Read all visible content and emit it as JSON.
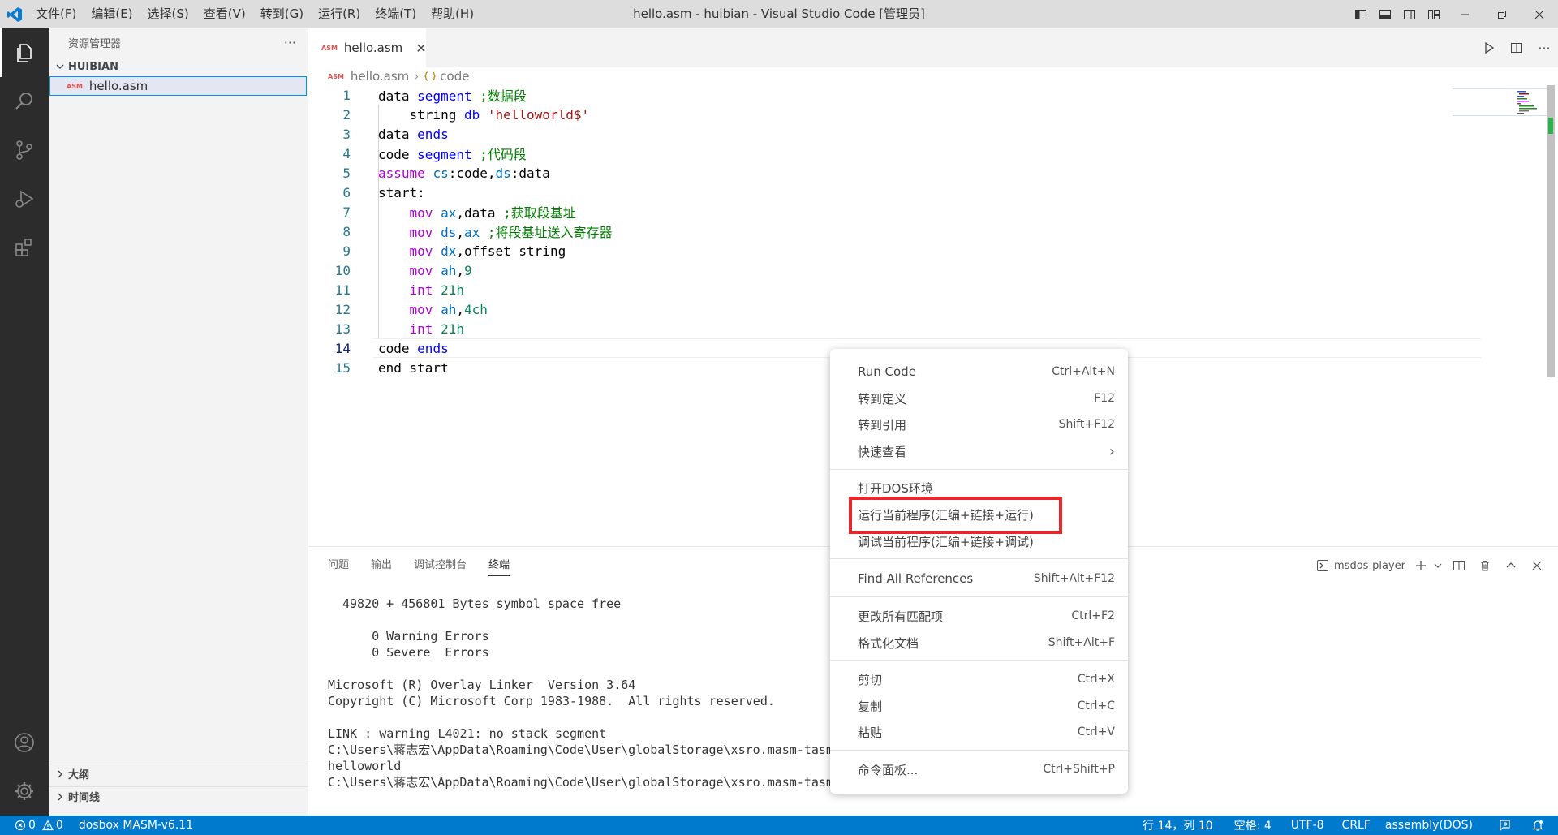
{
  "titlebar": {
    "menus": [
      "文件(F)",
      "编辑(E)",
      "选择(S)",
      "查看(V)",
      "转到(G)",
      "运行(R)",
      "终端(T)",
      "帮助(H)"
    ],
    "window_title": "hello.asm - huibian - Visual Studio Code [管理员]"
  },
  "sidebar": {
    "title": "资源管理器",
    "more": "···",
    "folder": "HUIBIAN",
    "file": "hello.asm",
    "file_tag": "ASM",
    "outline": "大纲",
    "timeline": "时间线"
  },
  "tab": {
    "label": "hello.asm",
    "tag": "ASM",
    "close": "✕"
  },
  "breadcrumb": {
    "file": "hello.asm",
    "symbol": "code"
  },
  "editor": {
    "line_numbers": [
      "1",
      "2",
      "3",
      "4",
      "5",
      "6",
      "7",
      "8",
      "9",
      "10",
      "11",
      "12",
      "13",
      "14",
      "15"
    ],
    "current_line": 14
  },
  "panel": {
    "tabs": [
      "问题",
      "输出",
      "调试控制台",
      "终端"
    ],
    "active_tab": "终端",
    "terminal_name": "msdos-player",
    "terminal_lines": [
      "49820 + 456801 Bytes symbol space free",
      "",
      "    0 Warning Errors",
      "    0 Severe  Errors",
      "",
      "Microsoft (R) Overlay Linker  Version 3.64",
      "Copyright (C) Microsoft Corp 1983-1988.  All rights reserved.",
      "",
      "LINK : warning L4021: no stack segment",
      "C:\\Users\\蒋志宏\\AppData\\Roaming\\Code\\User\\globalStorage\\xsro.masm-tasm",
      "helloworld",
      "C:\\Users\\蒋志宏\\AppData\\Roaming\\Code\\User\\globalStorage\\xsro.masm-tasm\\workspace>"
    ]
  },
  "context_menu": {
    "items": [
      {
        "label": "Run Code",
        "shortcut": "Ctrl+Alt+N"
      },
      {
        "label": "转到定义",
        "shortcut": "F12"
      },
      {
        "label": "转到引用",
        "shortcut": "Shift+F12"
      },
      {
        "label": "快速查看",
        "shortcut": "›"
      },
      {
        "label": "打开DOS环境",
        "shortcut": ""
      },
      {
        "label": "运行当前程序(汇编+链接+运行)",
        "shortcut": ""
      },
      {
        "label": "调试当前程序(汇编+链接+调试)",
        "shortcut": ""
      },
      {
        "label": "Find All References",
        "shortcut": "Shift+Alt+F12"
      },
      {
        "label": "更改所有匹配项",
        "shortcut": "Ctrl+F2"
      },
      {
        "label": "格式化文档",
        "shortcut": "Shift+Alt+F"
      },
      {
        "label": "剪切",
        "shortcut": "Ctrl+X"
      },
      {
        "label": "复制",
        "shortcut": "Ctrl+C"
      },
      {
        "label": "粘贴",
        "shortcut": "Ctrl+V"
      },
      {
        "label": "命令面板...",
        "shortcut": "Ctrl+Shift+P"
      }
    ]
  },
  "statusbar": {
    "errors": "0",
    "warnings": "0",
    "env": "dosbox MASM-v6.11",
    "position": "行 14，列 10",
    "spaces": "空格: 4",
    "encoding": "UTF-8",
    "eol": "CRLF",
    "language": "assembly(DOS)"
  },
  "colors": {
    "accent": "#007acc",
    "highlight_box": "#e8272d",
    "activity_bar": "#2c2c2c"
  }
}
